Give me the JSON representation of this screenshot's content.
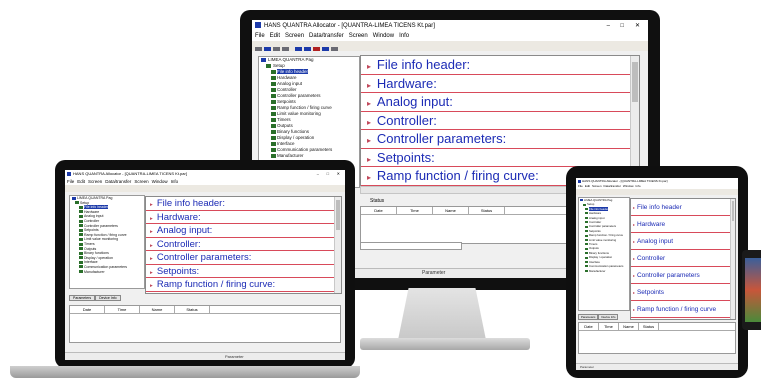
{
  "app": {
    "title": "HANS QUANTRA Allocator - [QUANTRA-LIMEA TICENS Kt.par]",
    "menu": [
      "File",
      "Edit",
      "Screen",
      "Data/transfer",
      "Screen",
      "Window",
      "Info"
    ],
    "root_node": "LIMEA QUANTRA Pag",
    "setup_node": "Setup",
    "tree_items": [
      "File info header",
      "Hardware",
      "Analog input",
      "Controller",
      "Controller parameters",
      "Setpoints",
      "Ramp function / firing curve",
      "Limit value monitoring",
      "Timers",
      "Outputs",
      "Binary functions",
      "Display / operation",
      "Interface",
      "Communication parameters",
      "Manufacturer"
    ],
    "sections": [
      "File info header:",
      "Hardware:",
      "Analog input:",
      "Controller:",
      "Controller parameters:",
      "Setpoints:",
      "Ramp function / firing curve:"
    ],
    "tablet_sections": [
      "File info header",
      "Hardware",
      "Analog input",
      "Controller",
      "Controller parameters",
      "Setpoints",
      "Ramp function / firing curve"
    ],
    "grid_headers": [
      "Date",
      "Time",
      "Name",
      "Status"
    ],
    "bottom_tabs": [
      "Parameters",
      "Device Info"
    ],
    "status_tab": "Status",
    "status_text": "Parameter",
    "colors": {
      "section_text": "#1c2bb5",
      "section_divider": "#d84a5a",
      "selection": "#1c3aa9",
      "device_frame": "#0f0f0f"
    },
    "icons": [
      "minimize-icon",
      "maximize-icon",
      "close-icon",
      "folder-icon",
      "expand-arrow-icon"
    ]
  }
}
